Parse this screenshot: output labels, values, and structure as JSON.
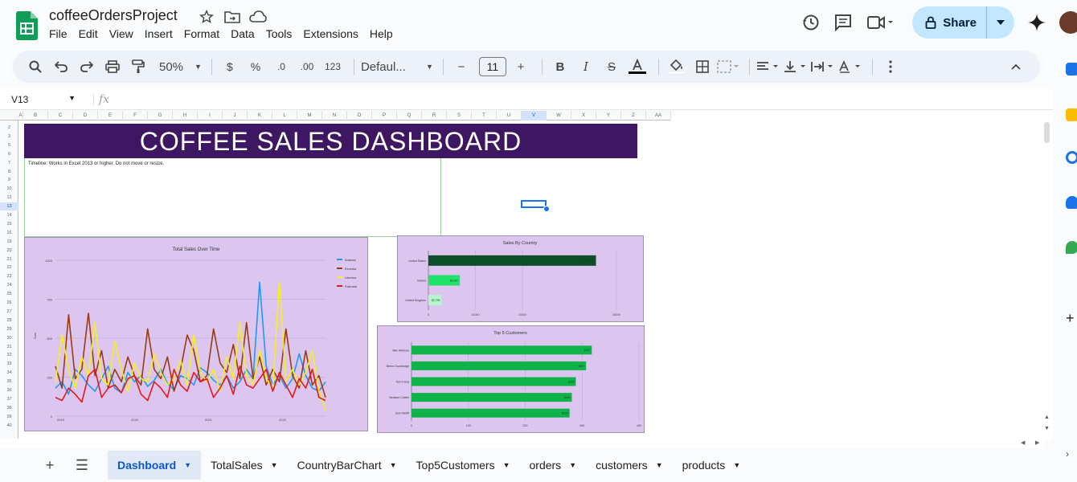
{
  "doc": {
    "title": "coffeeOrdersProject"
  },
  "menu": [
    "File",
    "Edit",
    "View",
    "Insert",
    "Format",
    "Data",
    "Tools",
    "Extensions",
    "Help"
  ],
  "header": {
    "share_label": "Share"
  },
  "toolbar": {
    "zoom": "50%",
    "currency": "$",
    "percent": "%",
    "dec_less": ".0",
    "dec_more": ".00",
    "format_123": "123",
    "font": "Defaul...",
    "font_size": "11",
    "minus": "−",
    "plus": "+"
  },
  "formula": {
    "cell_ref": "V13",
    "fx": "fx"
  },
  "columns": [
    "A",
    "B",
    "C",
    "D",
    "E",
    "F",
    "G",
    "H",
    "I",
    "J",
    "K",
    "L",
    "M",
    "N",
    "O",
    "P",
    "Q",
    "R",
    "S",
    "T",
    "U",
    "V",
    "W",
    "X",
    "Y",
    "Z",
    "AA"
  ],
  "active_column": "V",
  "rows": [
    "2",
    "3",
    "5",
    "6",
    "7",
    "8",
    "9",
    "10",
    "12",
    "13",
    "14",
    "15",
    "16",
    "19",
    "20",
    "21",
    "22",
    "23",
    "24",
    "25",
    "26",
    "27",
    "28",
    "29",
    "30",
    "31",
    "32",
    "33",
    "34",
    "35",
    "36",
    "37",
    "38",
    "39",
    "40"
  ],
  "active_row": "13",
  "dashboard": {
    "banner": "COFFEE SALES DASHBOARD",
    "timeline_note": "Timeline: Works in Excel 2013 or higher. Do not move or resize."
  },
  "chart_data": [
    {
      "type": "line",
      "title": "Total Sales Over Time",
      "ylabel": "Sum",
      "ylim": [
        0,
        1000
      ],
      "yticks": [
        0,
        250,
        500,
        750,
        1000
      ],
      "x_year_labels": [
        "2019",
        "2020",
        "2021",
        "2022"
      ],
      "legend_position": "top-right",
      "series": [
        {
          "name": "Arabica",
          "color": "#1e9bf0",
          "values": [
            180,
            220,
            140,
            300,
            260,
            200,
            160,
            240,
            320,
            180,
            150,
            280,
            220,
            260,
            190,
            230,
            300,
            210,
            170,
            260,
            240,
            200,
            310,
            280,
            230,
            200,
            260,
            180,
            220,
            300,
            240,
            860,
            320,
            200,
            260,
            180,
            240,
            400,
            260,
            180,
            160,
            220
          ]
        },
        {
          "name": "Excelsa",
          "color": "#9b3a10",
          "values": [
            320,
            180,
            650,
            240,
            300,
            660,
            260,
            420,
            180,
            300,
            220,
            380,
            260,
            200,
            560,
            300,
            240,
            380,
            160,
            300,
            520,
            420,
            220,
            260,
            560,
            340,
            280,
            460,
            240,
            600,
            240,
            380,
            200,
            300,
            220,
            560,
            260,
            180,
            420,
            200,
            260,
            120
          ]
        },
        {
          "name": "Liberica",
          "color": "#f7ef1a",
          "values": [
            220,
            520,
            300,
            180,
            380,
            260,
            600,
            240,
            200,
            480,
            300,
            160,
            340,
            240,
            220,
            400,
            280,
            200,
            240,
            360,
            200,
            520,
            280,
            220,
            300,
            160,
            380,
            240,
            600,
            260,
            200,
            420,
            240,
            180,
            860,
            220,
            300,
            200,
            280,
            420,
            160,
            40
          ]
        },
        {
          "name": "Robusta",
          "color": "#e81818",
          "values": [
            120,
            100,
            180,
            140,
            90,
            260,
            300,
            120,
            180,
            200,
            150,
            240,
            260,
            140,
            100,
            220,
            180,
            120,
            300,
            200,
            160,
            280,
            220,
            240,
            120,
            180,
            260,
            140,
            320,
            200,
            180,
            240,
            300,
            160,
            280,
            200,
            120,
            240,
            180,
            300,
            120,
            100
          ]
        }
      ]
    },
    {
      "type": "bar",
      "title": "Sales By Country",
      "categories": [
        "United States",
        "Ireland",
        "United Kingdom"
      ],
      "values": [
        35639,
        6697,
        2799
      ],
      "labels": [
        "$35,639",
        "$6,697",
        "$2,799"
      ],
      "xlim": [
        0,
        40000
      ],
      "xticks": [
        0,
        10000,
        20000,
        40000
      ],
      "xtick_labels": [
        "0",
        "10000",
        "20000",
        "40000"
      ],
      "colors": [
        "#0d4d2a",
        "#1fe36b",
        "#b7f5cc"
      ]
    },
    {
      "type": "bar",
      "title": "Top 5 Customers",
      "categories": [
        "Allis Wilmore",
        "Brenn Dundredge",
        "Terri Farra",
        "Nealson Cuttler",
        "Don Flintiff"
      ],
      "values": [
        317,
        307,
        289,
        282,
        278
      ],
      "labels": [
        "$317",
        "$307",
        "$289",
        "$282",
        "$278"
      ],
      "xlim": [
        0,
        400
      ],
      "xticks": [
        0,
        100,
        200,
        300,
        400
      ],
      "xtick_labels": [
        "0",
        "100",
        "200",
        "300",
        "400"
      ],
      "color": "#0fb34a"
    }
  ],
  "tabs": [
    "Dashboard",
    "TotalSales",
    "CountryBarChart",
    "Top5Customers",
    "orders",
    "customers",
    "products"
  ],
  "active_tab": "Dashboard"
}
